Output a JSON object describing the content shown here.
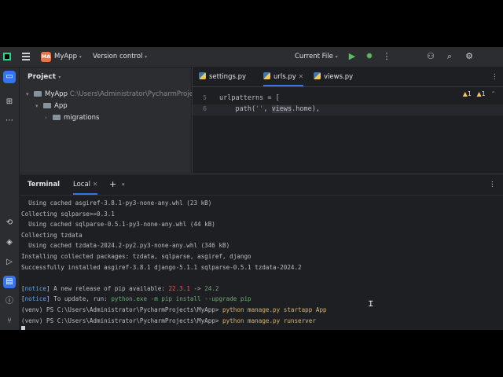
{
  "titlebar": {
    "project_badge": "MA",
    "project_name": "MyApp",
    "vcs_label": "Version control",
    "run_config": "Current File"
  },
  "project_panel": {
    "title": "Project",
    "root": {
      "name": "MyApp",
      "path": "C:\\Users\\Administrator\\PycharmProjects"
    },
    "children": [
      "App",
      "migrations"
    ]
  },
  "editor": {
    "tabs": [
      "settings.py",
      "urls.py",
      "views.py"
    ],
    "active_tab": "urls.py",
    "warnings": "1",
    "weak_warnings": "1",
    "lines": [
      {
        "num": "5",
        "text": "urlpatterns = ["
      },
      {
        "num": "6",
        "pre": "    path(",
        "str": "''",
        "mid": ", ",
        "hl": "views",
        "post": ".home),"
      }
    ]
  },
  "terminal": {
    "tab_terminal": "Terminal",
    "tab_local": "Local",
    "add_symbol": "+",
    "lines": [
      "  Using cached asgiref-3.8.1-py3-none-any.whl (23 kB)",
      "Collecting sqlparse>=0.3.1",
      "  Using cached sqlparse-0.5.1-py3-none-any.whl (44 kB)",
      "Collecting tzdata",
      "  Using cached tzdata-2024.2-py2.py3-none-any.whl (346 kB)",
      "Installing collected packages: tzdata, sqlparse, asgiref, django",
      "Successfully installed asgiref-3.8.1 django-5.1.1 sqlparse-0.5.1 tzdata-2024.2",
      ""
    ],
    "notice1": {
      "tag": "notice",
      "text": " A new release of pip available: ",
      "old": "22.3.1",
      "arrow": " -> ",
      "new": "24.2"
    },
    "notice2": {
      "tag": "notice",
      "text": " To update, run: ",
      "cmd": "python.exe -m pip install --upgrade pip"
    },
    "prompt1": {
      "prompt": "(venv) PS C:\\Users\\Administrator\\PycharmProjects\\MyApp> ",
      "cmd": "python manage.py startapp App"
    },
    "prompt2": {
      "prompt": "(venv) PS C:\\Users\\Administrator\\PycharmProjects\\MyApp> ",
      "cmd": "python manage.py runserver"
    }
  },
  "colors": {
    "accent": "#3574f0",
    "command": "#d5b778",
    "notice": "#56a8f5",
    "success": "#6aab73"
  },
  "icons": [
    "app-logo-icon",
    "hamburger-icon",
    "run-icon",
    "debug-icon",
    "more-icon",
    "add-user-icon",
    "search-icon",
    "settings-icon",
    "folder-icon",
    "terminal-icon"
  ]
}
